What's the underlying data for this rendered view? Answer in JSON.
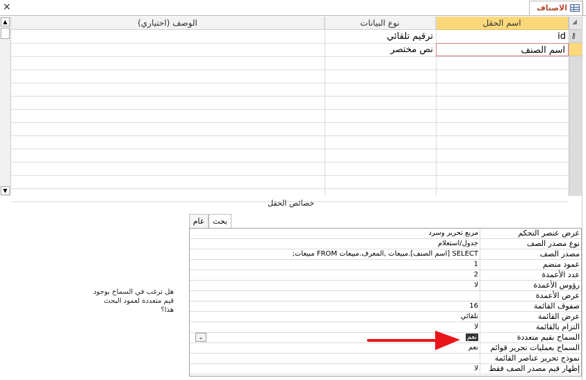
{
  "window": {
    "tab_title": "الاصناف",
    "close_glyph": "×",
    "tab_icon": "table-icon"
  },
  "grid": {
    "headers": {
      "field_name": "اسم الحقل",
      "data_type": "نوع البيانات",
      "description": "الوصف (اختياري)"
    },
    "rows": [
      {
        "field_name": "id",
        "data_type": "ترقيم تلقائي",
        "description": "",
        "primary_key": true
      },
      {
        "field_name": "اسم الصنف",
        "data_type": "نص مختصر",
        "description": ""
      }
    ],
    "key_icon": "key-icon"
  },
  "field_properties": {
    "title": "خصائص الحقل",
    "tabs": [
      "عام",
      "بحث"
    ],
    "active_tab": "بحث",
    "rows": [
      {
        "label": "عرض عنصر التحكم",
        "value": "مربع تحرير وسرد"
      },
      {
        "label": "نوع مصدر الصف",
        "value": "جدول/استعلام"
      },
      {
        "label": "مصدر الصف",
        "value": "SELECT [اسم الصنف].مبيعات ,المعرف.مبيعات FROM مبيعات;"
      },
      {
        "label": "عمود منضم",
        "value": "1"
      },
      {
        "label": "عدد الأعمدة",
        "value": "2"
      },
      {
        "label": "رؤوس الأعمدة",
        "value": "لا"
      },
      {
        "label": "عرض الأعمدة",
        "value": ""
      },
      {
        "label": "صفوف القائمة",
        "value": "16"
      },
      {
        "label": "عرض القائمة",
        "value": "تلقائي"
      },
      {
        "label": "التزام بالقائمة",
        "value": "لا"
      },
      {
        "label": "السماح بقيم متعددة",
        "value": "نعم",
        "selected": true
      },
      {
        "label": "السماح بعمليات تحرير قوائم",
        "value": "نعم"
      },
      {
        "label": "نموذج تحرير عناصر القائمة",
        "value": ""
      },
      {
        "label": "إظهار قيم مصدر الصف فقط",
        "value": "لا"
      }
    ],
    "help_text": "هل ترغب في السماح بوجود قيم متعددة لعمود البحث هذا؟"
  },
  "colors": {
    "accent_tab": "#b5472b",
    "selected_header": "#fbd97a",
    "arrow": "#e8161b"
  }
}
